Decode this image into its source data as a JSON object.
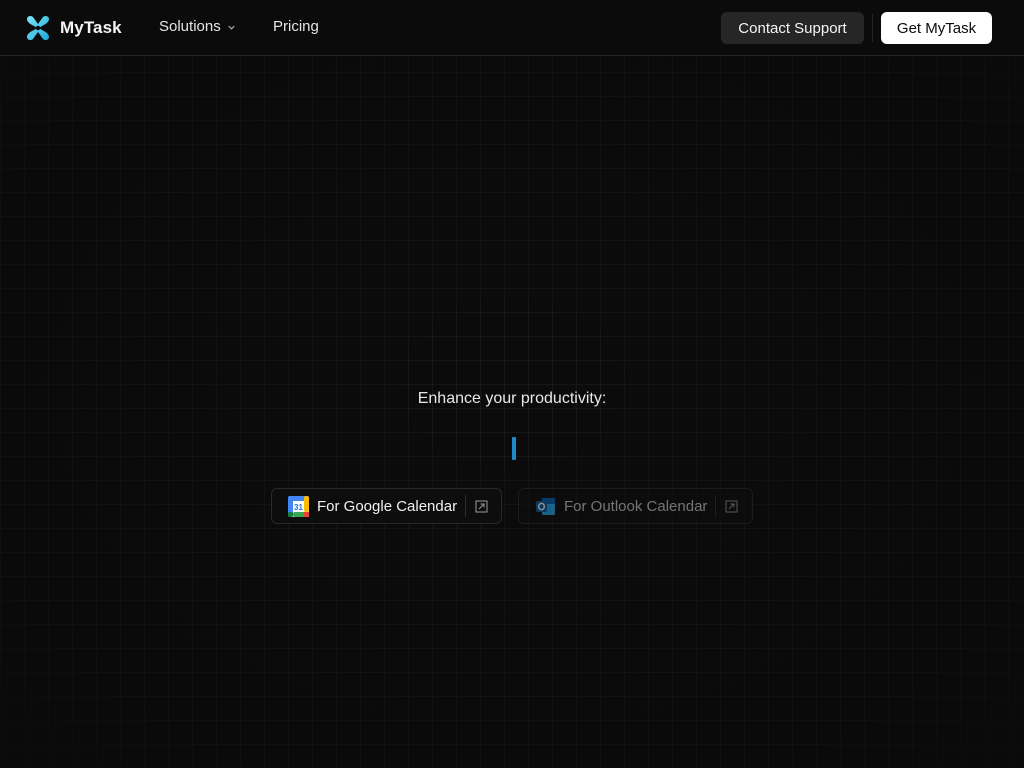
{
  "header": {
    "brand_name": "MyTask",
    "nav": {
      "solutions_label": "Solutions",
      "pricing_label": "Pricing"
    },
    "contact_support_label": "Contact Support",
    "get_app_label": "Get MyTask"
  },
  "hero": {
    "headline": "Enhance your productivity:",
    "typing_cursor_color": "#1e88c8",
    "buttons": [
      {
        "label": "For Google Calendar",
        "icon": "google-calendar-icon",
        "state": "active"
      },
      {
        "label": "For Outlook Calendar",
        "icon": "outlook-icon",
        "state": "dimmed"
      }
    ]
  },
  "icons": {
    "brand": "mytask-logo-icon",
    "solutions_dropdown": "chevron-down-icon",
    "external_link": "external-link-icon"
  },
  "colors": {
    "background": "#0a0a0a",
    "logo_accent": "#38c6e8",
    "primary_button_bg": "#ffffff",
    "secondary_button_bg": "#262626"
  }
}
